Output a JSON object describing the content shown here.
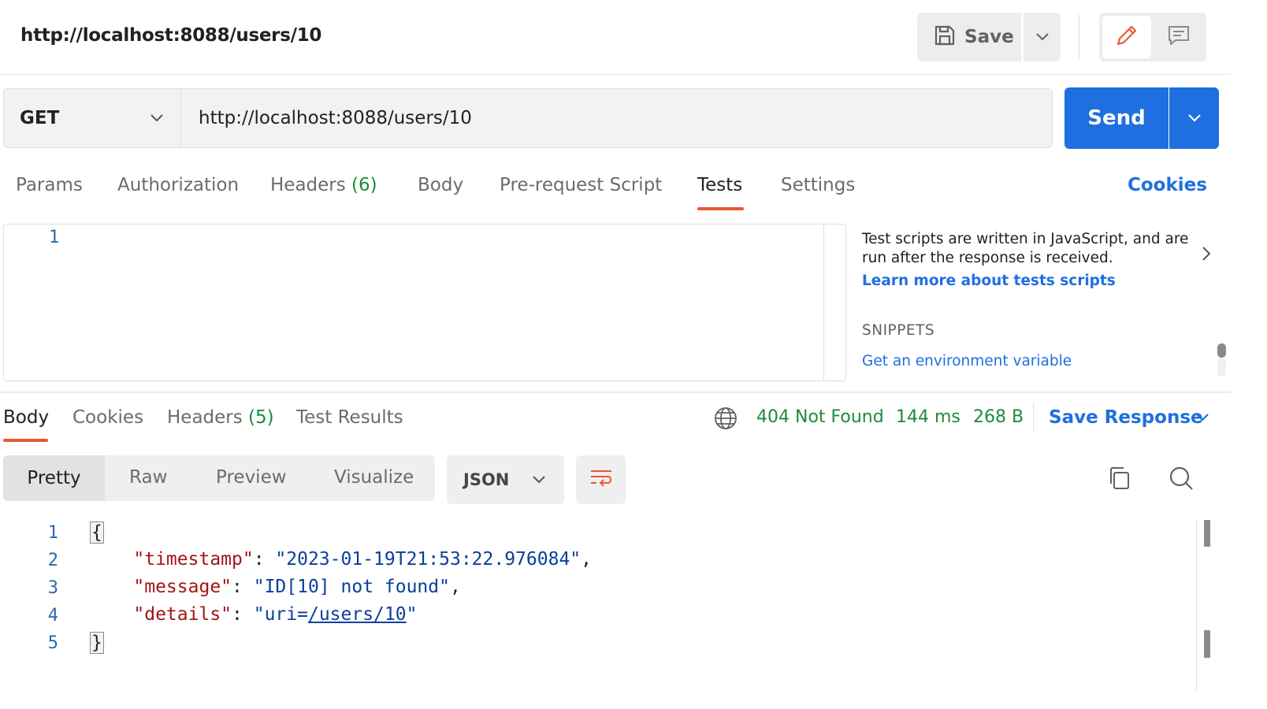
{
  "header": {
    "title": "http://localhost:8088/users/10",
    "save_label": "Save"
  },
  "request": {
    "method": "GET",
    "url": "http://localhost:8088/users/10",
    "send_label": "Send"
  },
  "request_tabs": {
    "params": "Params",
    "authorization": "Authorization",
    "headers": "Headers",
    "headers_count": "(6)",
    "body": "Body",
    "pre_request": "Pre-request Script",
    "tests": "Tests",
    "settings": "Settings",
    "active": "Tests",
    "cookies": "Cookies"
  },
  "editor": {
    "line_number": "1"
  },
  "help_panel": {
    "description": "Test scripts are written in JavaScript, and are run after the response is received.",
    "learn_more": "Learn more about tests scripts",
    "snippets_heading": "SNIPPETS",
    "snippet_1": "Get an environment variable"
  },
  "response_tabs": {
    "body": "Body",
    "cookies": "Cookies",
    "headers": "Headers",
    "headers_count": "(5)",
    "test_results": "Test Results",
    "active": "Body"
  },
  "response_status": {
    "status": "404 Not Found",
    "time": "144 ms",
    "size": "268 B",
    "save_response": "Save Response"
  },
  "format": {
    "pretty": "Pretty",
    "raw": "Raw",
    "preview": "Preview",
    "visualize": "Visualize",
    "active": "Pretty",
    "language": "JSON"
  },
  "response_body": {
    "line_numbers": [
      "1",
      "2",
      "3",
      "4",
      "5"
    ],
    "open_brace": "{",
    "close_brace": "}",
    "fields": [
      {
        "key": "\"timestamp\"",
        "value": "\"2023-01-19T21:53:22.976084\"",
        "trailing": ","
      },
      {
        "key": "\"message\"",
        "value": "\"ID[10] not found\"",
        "trailing": ","
      },
      {
        "key": "\"details\"",
        "value_prefix": "\"uri=",
        "value_link": "/users/10",
        "value_suffix": "\"",
        "trailing": ""
      }
    ]
  },
  "colors": {
    "accent_blue": "#1f6fe0",
    "tab_underline": "#e8582f",
    "status_green": "#1e8b3a",
    "json_key": "#a31515",
    "json_string": "#0a3f9a"
  },
  "icons": {
    "save": "save-icon",
    "chevron": "chevron-down-icon",
    "edit": "pencil-icon",
    "comment": "comment-icon",
    "globe": "globe-icon",
    "wrap": "word-wrap-icon",
    "copy": "copy-icon",
    "search": "search-icon",
    "help_expand": "chevron-right-icon"
  }
}
